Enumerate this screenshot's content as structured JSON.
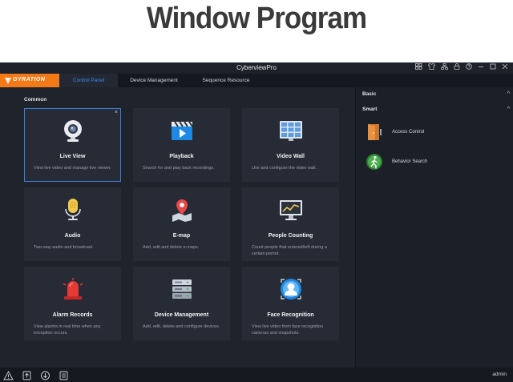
{
  "banner": {
    "title": "Window Program"
  },
  "window": {
    "title": "CyberviewPro",
    "controls": [
      "grid-icon",
      "shirt-icon",
      "sitemap-icon",
      "lock-icon",
      "help-icon",
      "minimize-icon",
      "maximize-icon",
      "close-icon"
    ]
  },
  "tabs": {
    "logo": "GYRATION",
    "items": [
      {
        "label": "Control Panel",
        "active": true
      },
      {
        "label": "Device Management",
        "active": false
      },
      {
        "label": "Sequence Resource",
        "active": false
      }
    ]
  },
  "main": {
    "section": "Common",
    "tiles": [
      {
        "name": "Live View",
        "desc": "View live video and manage live viewer.",
        "icon": "camera-icon",
        "selected": true
      },
      {
        "name": "Playback",
        "desc": "Search for and play back recordings.",
        "icon": "clapper-icon"
      },
      {
        "name": "Video Wall",
        "desc": "Use and configure the video wall.",
        "icon": "video-wall-icon"
      },
      {
        "name": "Audio",
        "desc": "Two-way audio and broadcast.",
        "icon": "microphone-icon"
      },
      {
        "name": "E-map",
        "desc": "Add, edit and delete e-maps.",
        "icon": "map-pin-icon"
      },
      {
        "name": "People Counting",
        "desc": "Count people that entered/left during a certain period.",
        "icon": "chart-monitor-icon"
      },
      {
        "name": "Alarm Records",
        "desc": "View alarms in real time when any exception occurs.",
        "icon": "alarm-light-icon"
      },
      {
        "name": "Device Management",
        "desc": "Add, edit, delete and configure devices.",
        "icon": "server-icon"
      },
      {
        "name": "Face Recognition",
        "desc": "View live video from face recognition cameras and snapshots.",
        "icon": "face-icon"
      }
    ],
    "close_glyph": "×"
  },
  "side": {
    "basic": "Basic",
    "smart": "Smart",
    "items": [
      {
        "label": "Access Control",
        "icon": "door-icon"
      },
      {
        "label": "Behavior Search",
        "icon": "walker-icon"
      }
    ],
    "chevron": "^"
  },
  "status": {
    "icons": [
      "warning-icon",
      "upload-icon",
      "download-icon",
      "log-icon"
    ],
    "user": "admin"
  },
  "colors": {
    "accent": "#f47a17",
    "active_tab_text": "#3d8cf0",
    "selection": "#3d7fd8"
  }
}
